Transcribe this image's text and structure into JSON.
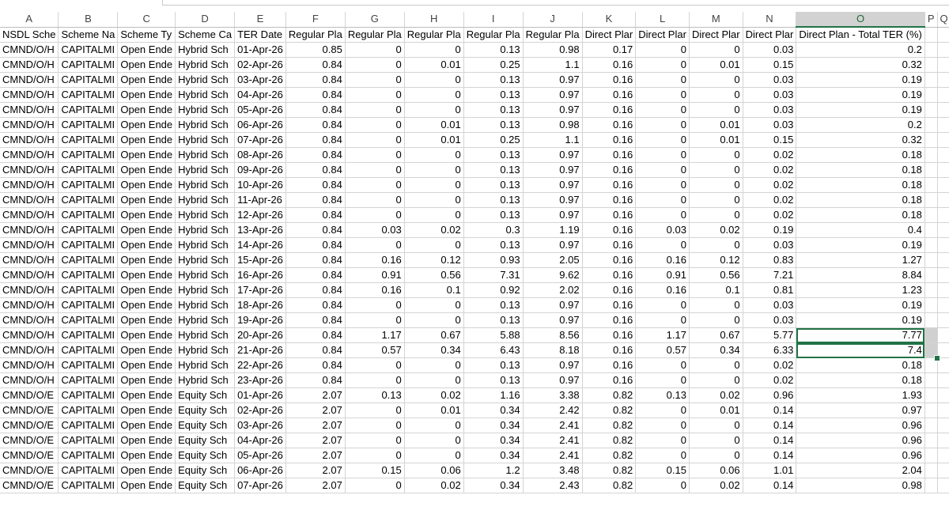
{
  "colors": {
    "accent": "#217346",
    "gridline": "#d4d4d4",
    "selection_fill": "#d0d0d0"
  },
  "columns": [
    "A",
    "B",
    "C",
    "D",
    "E",
    "F",
    "G",
    "H",
    "I",
    "J",
    "K",
    "L",
    "M",
    "N",
    "O",
    "P",
    "Q"
  ],
  "selected_column": "O",
  "headers": [
    "NSDL Sche",
    "Scheme Na",
    "Scheme Ty",
    "Scheme Ca",
    "TER Date",
    "Regular Pla",
    "Regular Pla",
    "Regular Pla",
    "Regular Pla",
    "Regular Pla",
    "Direct Plar",
    "Direct Plar",
    "Direct Plar",
    "Direct Plar",
    "Direct Plan - Total TER (%)"
  ],
  "rows": [
    [
      "CMND/O/H",
      "CAPITALMI",
      "Open Ende",
      "Hybrid Sch",
      "01-Apr-26",
      "0.85",
      "0",
      "0",
      "0.13",
      "0.98",
      "0.17",
      "0",
      "0",
      "0.03",
      "0.2"
    ],
    [
      "CMND/O/H",
      "CAPITALMI",
      "Open Ende",
      "Hybrid Sch",
      "02-Apr-26",
      "0.84",
      "0",
      "0.01",
      "0.25",
      "1.1",
      "0.16",
      "0",
      "0.01",
      "0.15",
      "0.32"
    ],
    [
      "CMND/O/H",
      "CAPITALMI",
      "Open Ende",
      "Hybrid Sch",
      "03-Apr-26",
      "0.84",
      "0",
      "0",
      "0.13",
      "0.97",
      "0.16",
      "0",
      "0",
      "0.03",
      "0.19"
    ],
    [
      "CMND/O/H",
      "CAPITALMI",
      "Open Ende",
      "Hybrid Sch",
      "04-Apr-26",
      "0.84",
      "0",
      "0",
      "0.13",
      "0.97",
      "0.16",
      "0",
      "0",
      "0.03",
      "0.19"
    ],
    [
      "CMND/O/H",
      "CAPITALMI",
      "Open Ende",
      "Hybrid Sch",
      "05-Apr-26",
      "0.84",
      "0",
      "0",
      "0.13",
      "0.97",
      "0.16",
      "0",
      "0",
      "0.03",
      "0.19"
    ],
    [
      "CMND/O/H",
      "CAPITALMI",
      "Open Ende",
      "Hybrid Sch",
      "06-Apr-26",
      "0.84",
      "0",
      "0.01",
      "0.13",
      "0.98",
      "0.16",
      "0",
      "0.01",
      "0.03",
      "0.2"
    ],
    [
      "CMND/O/H",
      "CAPITALMI",
      "Open Ende",
      "Hybrid Sch",
      "07-Apr-26",
      "0.84",
      "0",
      "0.01",
      "0.25",
      "1.1",
      "0.16",
      "0",
      "0.01",
      "0.15",
      "0.32"
    ],
    [
      "CMND/O/H",
      "CAPITALMI",
      "Open Ende",
      "Hybrid Sch",
      "08-Apr-26",
      "0.84",
      "0",
      "0",
      "0.13",
      "0.97",
      "0.16",
      "0",
      "0",
      "0.02",
      "0.18"
    ],
    [
      "CMND/O/H",
      "CAPITALMI",
      "Open Ende",
      "Hybrid Sch",
      "09-Apr-26",
      "0.84",
      "0",
      "0",
      "0.13",
      "0.97",
      "0.16",
      "0",
      "0",
      "0.02",
      "0.18"
    ],
    [
      "CMND/O/H",
      "CAPITALMI",
      "Open Ende",
      "Hybrid Sch",
      "10-Apr-26",
      "0.84",
      "0",
      "0",
      "0.13",
      "0.97",
      "0.16",
      "0",
      "0",
      "0.02",
      "0.18"
    ],
    [
      "CMND/O/H",
      "CAPITALMI",
      "Open Ende",
      "Hybrid Sch",
      "11-Apr-26",
      "0.84",
      "0",
      "0",
      "0.13",
      "0.97",
      "0.16",
      "0",
      "0",
      "0.02",
      "0.18"
    ],
    [
      "CMND/O/H",
      "CAPITALMI",
      "Open Ende",
      "Hybrid Sch",
      "12-Apr-26",
      "0.84",
      "0",
      "0",
      "0.13",
      "0.97",
      "0.16",
      "0",
      "0",
      "0.02",
      "0.18"
    ],
    [
      "CMND/O/H",
      "CAPITALMI",
      "Open Ende",
      "Hybrid Sch",
      "13-Apr-26",
      "0.84",
      "0.03",
      "0.02",
      "0.3",
      "1.19",
      "0.16",
      "0.03",
      "0.02",
      "0.19",
      "0.4"
    ],
    [
      "CMND/O/H",
      "CAPITALMI",
      "Open Ende",
      "Hybrid Sch",
      "14-Apr-26",
      "0.84",
      "0",
      "0",
      "0.13",
      "0.97",
      "0.16",
      "0",
      "0",
      "0.03",
      "0.19"
    ],
    [
      "CMND/O/H",
      "CAPITALMI",
      "Open Ende",
      "Hybrid Sch",
      "15-Apr-26",
      "0.84",
      "0.16",
      "0.12",
      "0.93",
      "2.05",
      "0.16",
      "0.16",
      "0.12",
      "0.83",
      "1.27"
    ],
    [
      "CMND/O/H",
      "CAPITALMI",
      "Open Ende",
      "Hybrid Sch",
      "16-Apr-26",
      "0.84",
      "0.91",
      "0.56",
      "7.31",
      "9.62",
      "0.16",
      "0.91",
      "0.56",
      "7.21",
      "8.84"
    ],
    [
      "CMND/O/H",
      "CAPITALMI",
      "Open Ende",
      "Hybrid Sch",
      "17-Apr-26",
      "0.84",
      "0.16",
      "0.1",
      "0.92",
      "2.02",
      "0.16",
      "0.16",
      "0.1",
      "0.81",
      "1.23"
    ],
    [
      "CMND/O/H",
      "CAPITALMI",
      "Open Ende",
      "Hybrid Sch",
      "18-Apr-26",
      "0.84",
      "0",
      "0",
      "0.13",
      "0.97",
      "0.16",
      "0",
      "0",
      "0.03",
      "0.19"
    ],
    [
      "CMND/O/H",
      "CAPITALMI",
      "Open Ende",
      "Hybrid Sch",
      "19-Apr-26",
      "0.84",
      "0",
      "0",
      "0.13",
      "0.97",
      "0.16",
      "0",
      "0",
      "0.03",
      "0.19"
    ],
    [
      "CMND/O/H",
      "CAPITALMI",
      "Open Ende",
      "Hybrid Sch",
      "20-Apr-26",
      "0.84",
      "1.17",
      "0.67",
      "5.88",
      "8.56",
      "0.16",
      "1.17",
      "0.67",
      "5.77",
      "7.77"
    ],
    [
      "CMND/O/H",
      "CAPITALMI",
      "Open Ende",
      "Hybrid Sch",
      "21-Apr-26",
      "0.84",
      "0.57",
      "0.34",
      "6.43",
      "8.18",
      "0.16",
      "0.57",
      "0.34",
      "6.33",
      "7.4"
    ],
    [
      "CMND/O/H",
      "CAPITALMI",
      "Open Ende",
      "Hybrid Sch",
      "22-Apr-26",
      "0.84",
      "0",
      "0",
      "0.13",
      "0.97",
      "0.16",
      "0",
      "0",
      "0.02",
      "0.18"
    ],
    [
      "CMND/O/H",
      "CAPITALMI",
      "Open Ende",
      "Hybrid Sch",
      "23-Apr-26",
      "0.84",
      "0",
      "0",
      "0.13",
      "0.97",
      "0.16",
      "0",
      "0",
      "0.02",
      "0.18"
    ],
    [
      "CMND/O/E",
      "CAPITALMI",
      "Open Ende",
      "Equity Sch",
      "01-Apr-26",
      "2.07",
      "0.13",
      "0.02",
      "1.16",
      "3.38",
      "0.82",
      "0.13",
      "0.02",
      "0.96",
      "1.93"
    ],
    [
      "CMND/O/E",
      "CAPITALMI",
      "Open Ende",
      "Equity Sch",
      "02-Apr-26",
      "2.07",
      "0",
      "0.01",
      "0.34",
      "2.42",
      "0.82",
      "0",
      "0.01",
      "0.14",
      "0.97"
    ],
    [
      "CMND/O/E",
      "CAPITALMI",
      "Open Ende",
      "Equity Sch",
      "03-Apr-26",
      "2.07",
      "0",
      "0",
      "0.34",
      "2.41",
      "0.82",
      "0",
      "0",
      "0.14",
      "0.96"
    ],
    [
      "CMND/O/E",
      "CAPITALMI",
      "Open Ende",
      "Equity Sch",
      "04-Apr-26",
      "2.07",
      "0",
      "0",
      "0.34",
      "2.41",
      "0.82",
      "0",
      "0",
      "0.14",
      "0.96"
    ],
    [
      "CMND/O/E",
      "CAPITALMI",
      "Open Ende",
      "Equity Sch",
      "05-Apr-26",
      "2.07",
      "0",
      "0",
      "0.34",
      "2.41",
      "0.82",
      "0",
      "0",
      "0.14",
      "0.96"
    ],
    [
      "CMND/O/E",
      "CAPITALMI",
      "Open Ende",
      "Equity Sch",
      "06-Apr-26",
      "2.07",
      "0.15",
      "0.06",
      "1.2",
      "3.48",
      "0.82",
      "0.15",
      "0.06",
      "1.01",
      "2.04"
    ],
    [
      "CMND/O/E",
      "CAPITALMI",
      "Open Ende",
      "Equity Sch",
      "07-Apr-26",
      "2.07",
      "0",
      "0.02",
      "0.34",
      "2.43",
      "0.82",
      "0",
      "0.02",
      "0.14",
      "0.98"
    ]
  ],
  "selected_rows": [
    19,
    20
  ]
}
